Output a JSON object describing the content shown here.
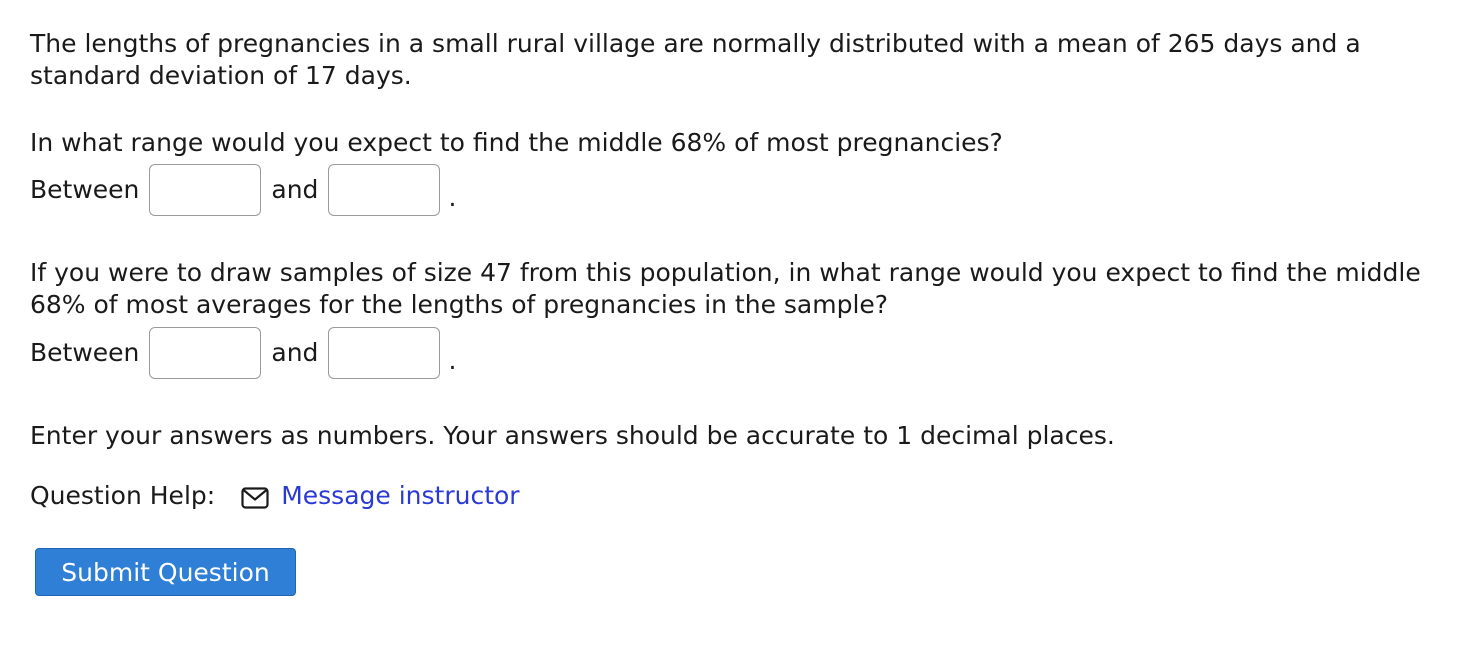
{
  "question": {
    "intro": "The lengths of pregnancies in a small rural village are normally distributed with a mean of 265 days and a standard deviation of 17 days.",
    "part1": {
      "prompt": "In what range would you expect to find the middle 68% of most pregnancies?",
      "between_label": "Between",
      "and_label": "and",
      "period": ".",
      "input1_value": "",
      "input2_value": ""
    },
    "part2": {
      "prompt": "If you were to draw samples of size 47 from this population, in what range would you expect to find the middle 68% of most averages for the lengths of pregnancies in the sample?",
      "between_label": "Between",
      "and_label": "and",
      "period": ".",
      "input1_value": "",
      "input2_value": ""
    },
    "instructions": "Enter your answers as numbers. Your answers should be accurate to 1 decimal places."
  },
  "help": {
    "label": "Question Help:",
    "icon": "mail-icon",
    "link_text": "Message instructor"
  },
  "submit": {
    "label": "Submit Question"
  },
  "colors": {
    "link": "#2b3ad6",
    "button_bg": "#2f7fd6",
    "button_text": "#ffffff",
    "input_border": "#9a9a9a"
  }
}
